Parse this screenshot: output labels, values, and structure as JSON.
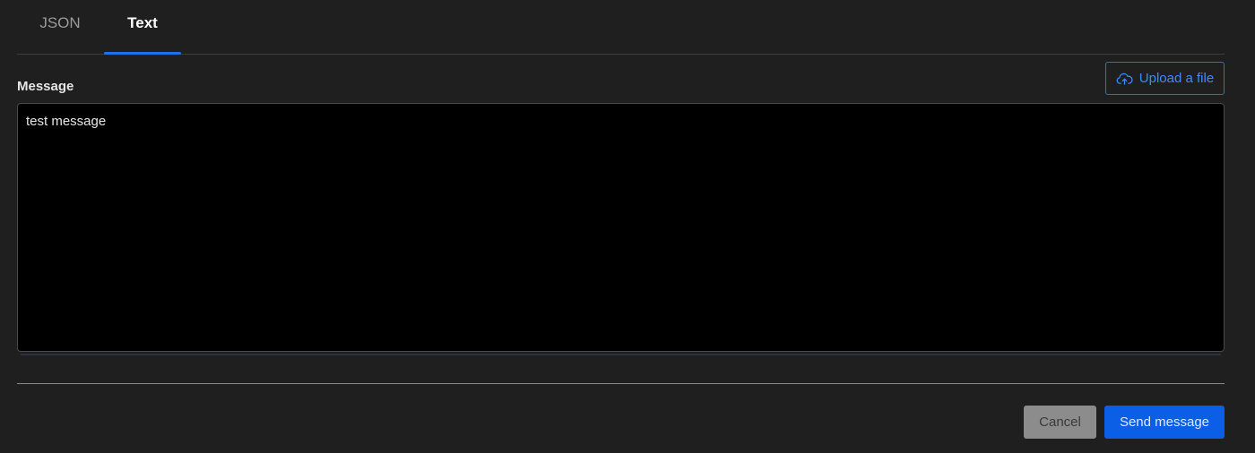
{
  "tabs": {
    "items": [
      {
        "label": "JSON",
        "active": false
      },
      {
        "label": "Text",
        "active": true
      }
    ]
  },
  "upload": {
    "label": "Upload a file",
    "icon": "cloud-upload-icon"
  },
  "message": {
    "label": "Message",
    "value": "test message"
  },
  "footer": {
    "cancel_label": "Cancel",
    "send_label": "Send message"
  },
  "colors": {
    "background": "#1f1f1f",
    "accent": "#1a73e8",
    "primary_button": "#0b5ee6",
    "secondary_button": "#8c8c8c",
    "textarea_bg": "#000000"
  }
}
